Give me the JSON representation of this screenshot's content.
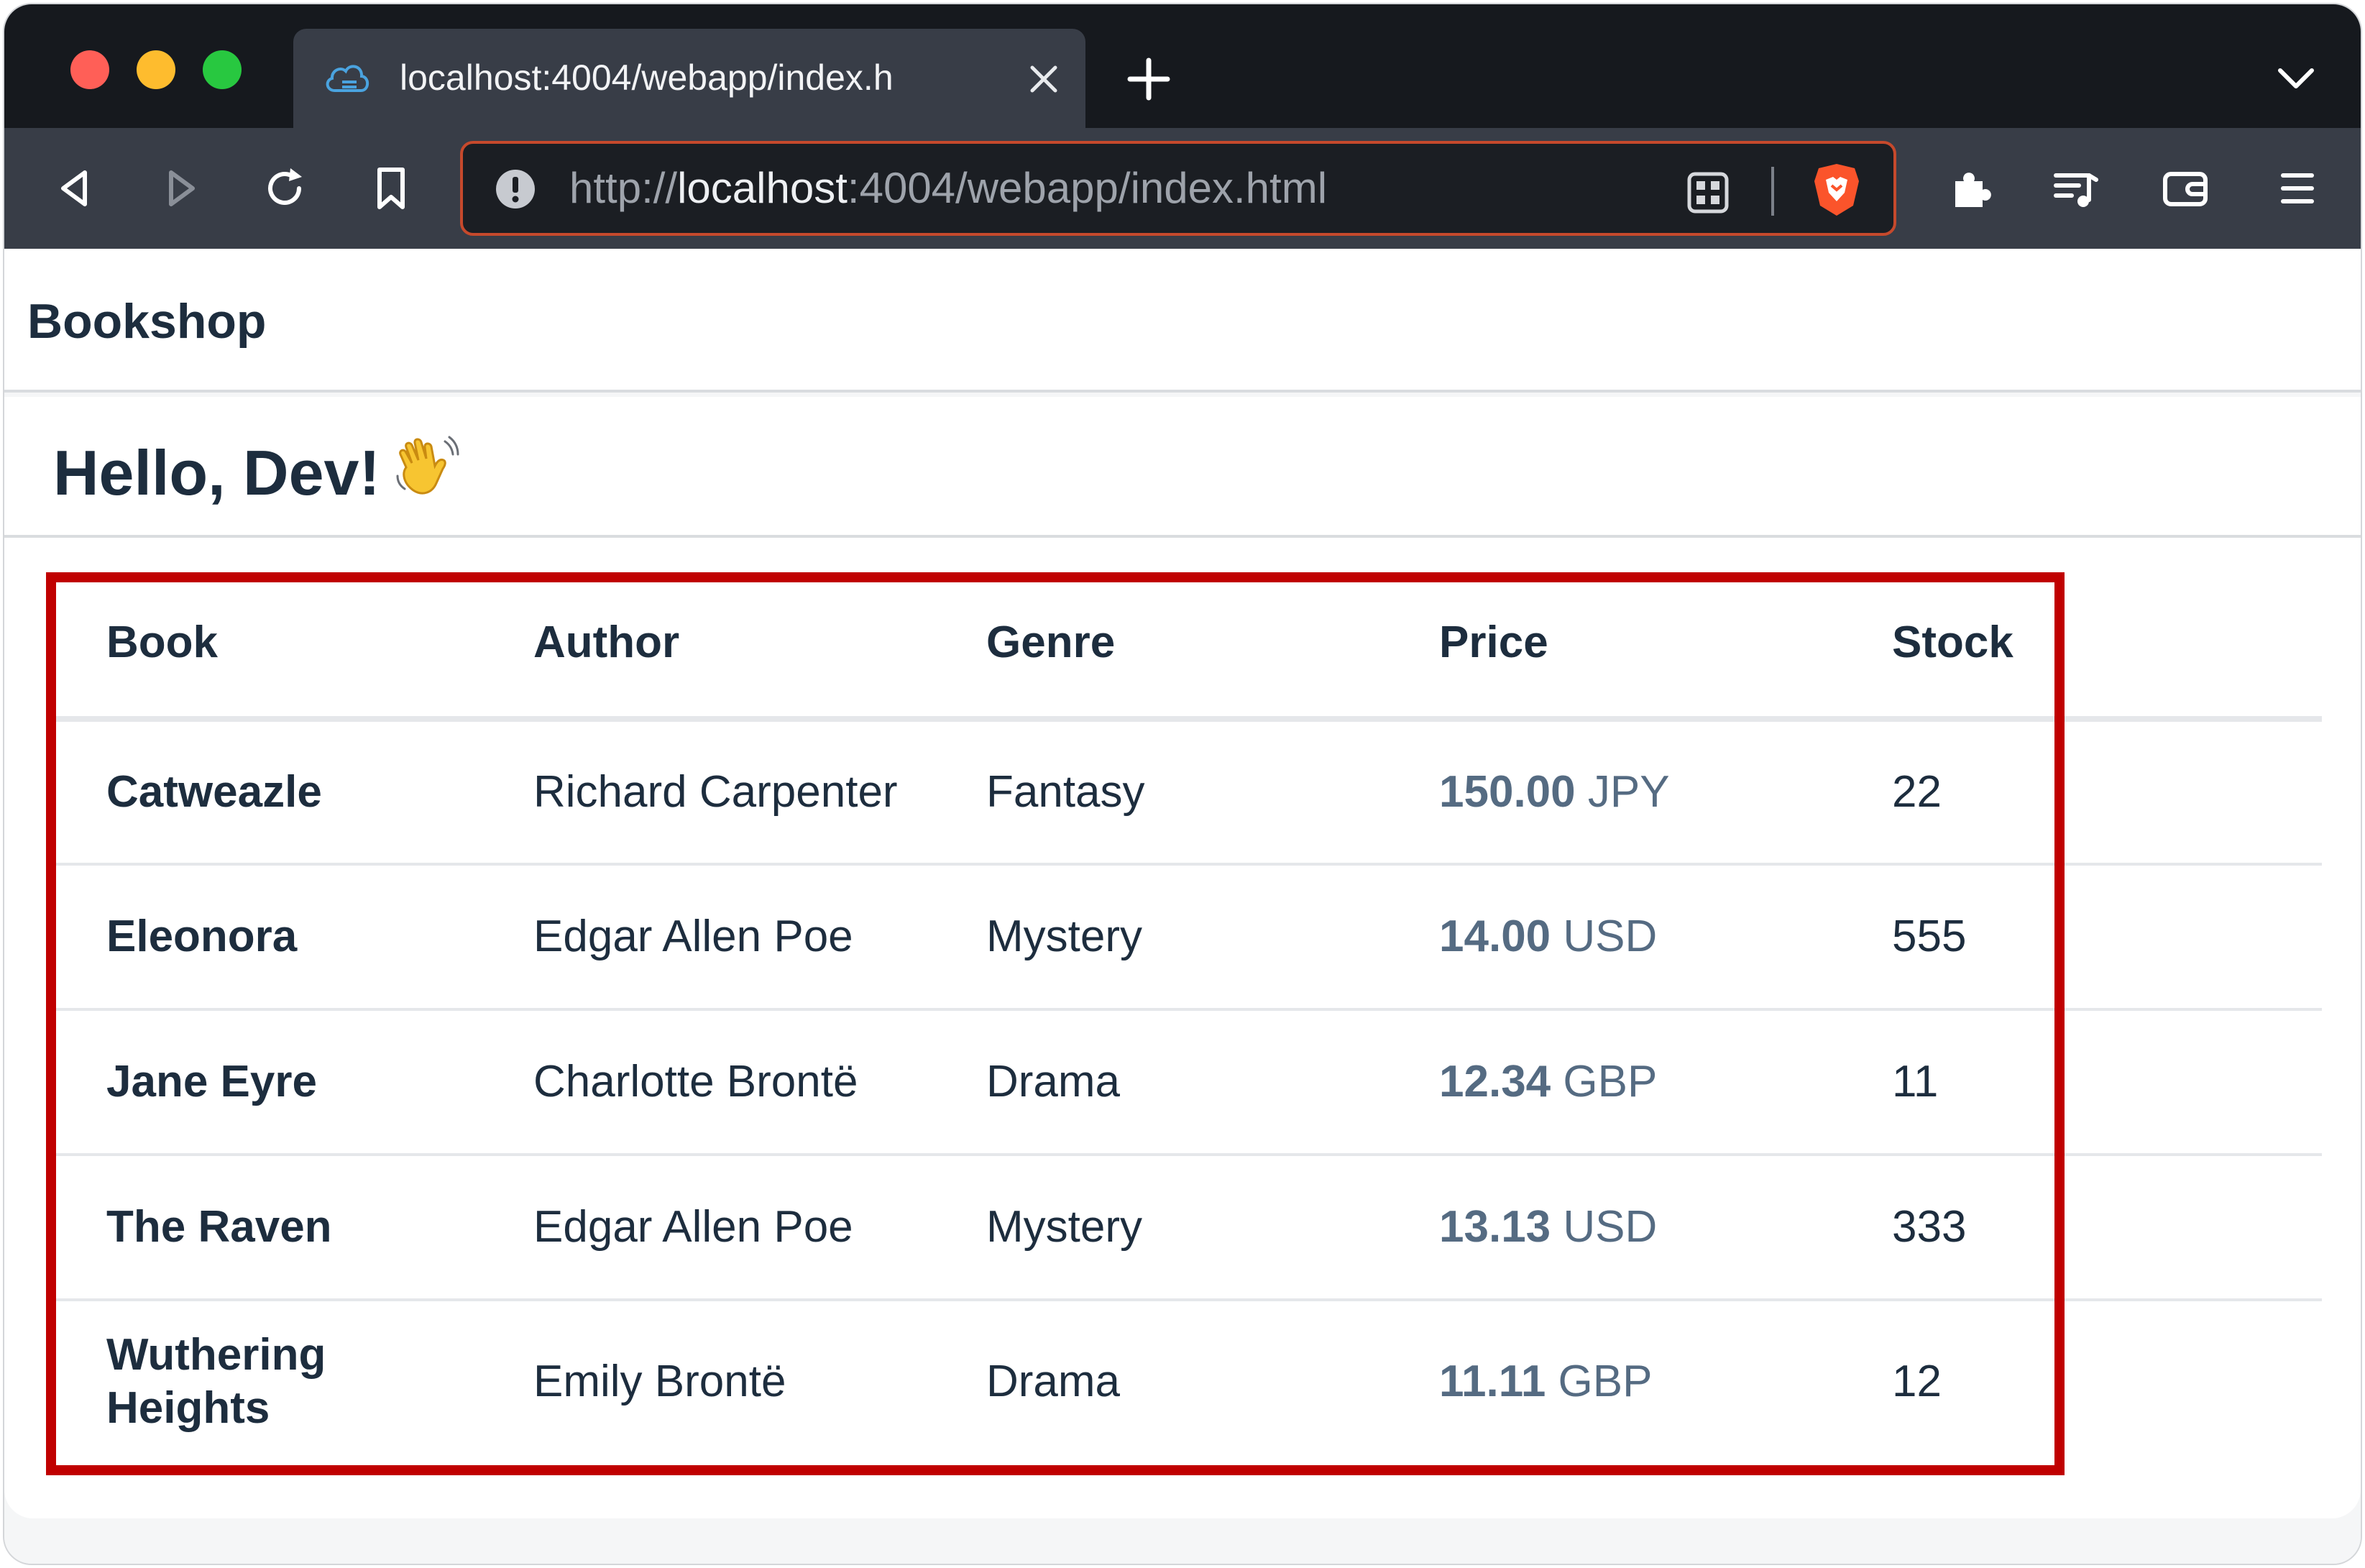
{
  "browser": {
    "tab": {
      "title": "localhost:4004/webapp/index.h"
    },
    "url": {
      "scheme": "http://",
      "host": "localhost",
      "rest": ":4004/webapp/index.html"
    },
    "colors": {
      "url_focus_border": "#c6492c",
      "brave_accent": "#fb542b"
    },
    "icons": [
      "back-icon",
      "forward-icon",
      "reload-icon",
      "bookmark-icon",
      "info-icon",
      "qr-code-icon",
      "brave-shields-icon",
      "extensions-icon",
      "playlist-icon",
      "wallet-icon",
      "menu-icon"
    ]
  },
  "app": {
    "title": "Bookshop",
    "greeting": "Hello, Dev!",
    "greeting_emoji": "👋"
  },
  "table": {
    "headers": [
      "Book",
      "Author",
      "Genre",
      "Price",
      "Stock"
    ],
    "rows": [
      {
        "book": "Catweazle",
        "author": "Richard Carpenter",
        "genre": "Fantasy",
        "price": "150.00",
        "currency": "JPY",
        "stock": "22"
      },
      {
        "book": "Eleonora",
        "author": "Edgar Allen Poe",
        "genre": "Mystery",
        "price": "14.00",
        "currency": "USD",
        "stock": "555"
      },
      {
        "book": "Jane Eyre",
        "author": "Charlotte Brontë",
        "genre": "Drama",
        "price": "12.34",
        "currency": "GBP",
        "stock": "11"
      },
      {
        "book": "The Raven",
        "author": "Edgar Allen Poe",
        "genre": "Mystery",
        "price": "13.13",
        "currency": "USD",
        "stock": "333"
      },
      {
        "book": "Wuthering Heights",
        "author": "Emily Brontë",
        "genre": "Drama",
        "price": "11.11",
        "currency": "GBP",
        "stock": "12"
      }
    ],
    "highlight_color": "#c00000"
  }
}
